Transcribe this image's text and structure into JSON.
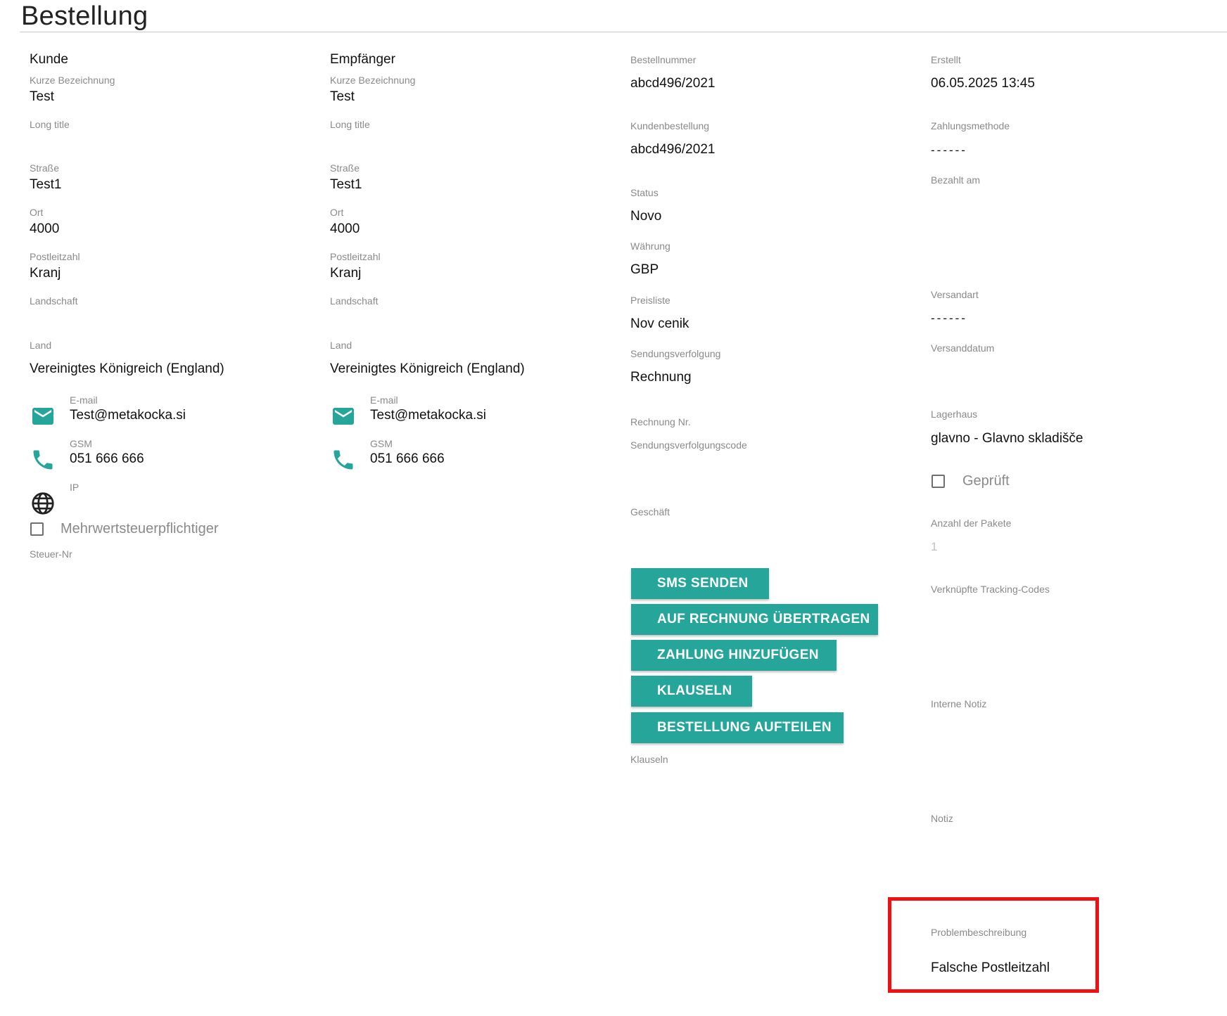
{
  "page": {
    "title": "Bestellung"
  },
  "customer": {
    "heading": "Kunde",
    "short_label": "Kurze Bezeichnung",
    "short_value": "Test",
    "long_label": "Long title",
    "street_label": "Straße",
    "street_value": "Test1",
    "city_label": "Ort",
    "city_value": "4000",
    "zip_label": "Postleitzahl",
    "zip_value": "Kranj",
    "region_label": "Landschaft",
    "country_label": "Land",
    "country_value": "Vereinigtes Königreich (England)",
    "email_label": "E-mail",
    "email_value": "Test@metakocka.si",
    "gsm_label": "GSM",
    "gsm_value": "051 666 666",
    "ip_label": "IP",
    "vat_label": "Mehrwertsteuerpflichtiger",
    "taxno_label": "Steuer-Nr"
  },
  "recipient": {
    "heading": "Empfänger",
    "short_label": "Kurze Bezeichnung",
    "short_value": "Test",
    "long_label": "Long title",
    "street_label": "Straße",
    "street_value": "Test1",
    "city_label": "Ort",
    "city_value": "4000",
    "zip_label": "Postleitzahl",
    "zip_value": "Kranj",
    "region_label": "Landschaft",
    "country_label": "Land",
    "country_value": "Vereinigtes Königreich (England)",
    "email_label": "E-mail",
    "email_value": "Test@metakocka.si",
    "gsm_label": "GSM",
    "gsm_value": "051 666 666"
  },
  "order": {
    "number_label": "Bestellnummer",
    "number_value": "abcd496/2021",
    "customer_order_label": "Kundenbestellung",
    "customer_order_value": "abcd496/2021",
    "status_label": "Status",
    "status_value": "Novo",
    "currency_label": "Währung",
    "currency_value": "GBP",
    "pricelist_label": "Preisliste",
    "pricelist_value": "Nov cenik",
    "tracking_label": "Sendungsverfolgung",
    "tracking_value": "Rechnung",
    "invoice_no_label": "Rechnung Nr.",
    "tracking_code_label": "Sendungsverfolgungscode",
    "business_label": "Geschäft",
    "clauses_label": "Klauseln"
  },
  "buttons": {
    "sms": "SMS SENDEN",
    "transfer": "AUF RECHNUNG ÜBERTRAGEN",
    "payment": "ZAHLUNG HINZUFÜGEN",
    "clauses": "KLAUSELN",
    "split": "BESTELLUNG AUFTEILEN"
  },
  "meta": {
    "created_label": "Erstellt",
    "created_value": "06.05.2025 13:45",
    "payment_method_label": "Zahlungsmethode",
    "payment_method_value": "------",
    "paid_on_label": "Bezahlt am",
    "shipping_type_label": "Versandart",
    "shipping_type_value": "------",
    "shipping_date_label": "Versanddatum",
    "warehouse_label": "Lagerhaus",
    "warehouse_value": "glavno - Glavno skladišče",
    "checked_label": "Geprüft",
    "packages_label": "Anzahl der Pakete",
    "packages_value": "1",
    "linked_codes_label": "Verknüpfte Tracking-Codes",
    "internal_note_label": "Interne Notiz",
    "note_label": "Notiz",
    "problem_label": "Problembeschreibung",
    "problem_value": "Falsche Postleitzahl"
  },
  "icons": {
    "email": "mail-icon",
    "phone": "phone-icon",
    "ip": "globe-icon"
  },
  "colors": {
    "accent": "#26a69a",
    "highlight": "#ee1111",
    "label": "#8a8a8a"
  }
}
